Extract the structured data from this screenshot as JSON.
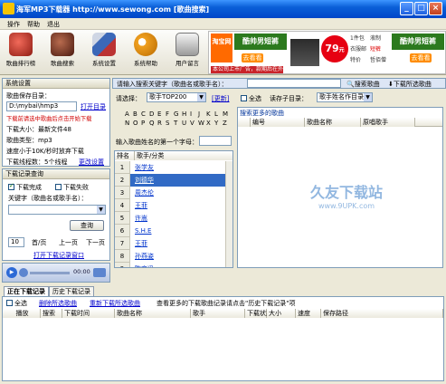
{
  "window": {
    "title": "海军MP3下载器   http://www.sewong.com   [歌曲搜索]",
    "minimize": "_",
    "maximize": "□",
    "close": "×"
  },
  "menu": [
    "操作",
    "帮助",
    "退出"
  ],
  "toolbar": [
    {
      "label": "歌曲排行榜",
      "icon": "music-chart-icon",
      "color": "#c23a2e"
    },
    {
      "label": "歌曲搜索",
      "icon": "music-search-icon",
      "color": "#7d3525"
    },
    {
      "label": "系统设置",
      "icon": "settings-tools-icon",
      "color": "#3b68b8"
    },
    {
      "label": "系统帮助",
      "icon": "owl-help-icon",
      "color": "#e08a00"
    },
    {
      "label": "用户留言",
      "icon": "guestbook-icon",
      "color": "#8b8b8b"
    }
  ],
  "ad": {
    "brand": "淘宝网",
    "slogan": "酷帅男短裤",
    "cta": "去看看",
    "price": "79",
    "price_unit": "元",
    "tagline": "潮流 型格 短裤",
    "right_items": [
      "1件包",
      "液制",
      "衣服邮",
      "短裤",
      "特价",
      "哲佰僧"
    ],
    "right_title": "酷帅男短裤",
    "right_cta": "去看看",
    "notice": "本公司上市广告，款期后在外"
  },
  "system_settings": {
    "header": "系统设置",
    "save_dir_label": "歌曲保存目录：",
    "save_dir_value": "D:\\mybai\\hmp3",
    "open_dir": "打开目录",
    "warning": "下载前请选中歌曲后点击开始下载",
    "size_label": "下载大小：最新文件48",
    "type_label": "歌曲类型：mp3",
    "speed_label": "速度小于10K/秒时放弃下载",
    "threads_label": "下载线程数：5个线程",
    "change_settings": "更改设置"
  },
  "download_query": {
    "header": "下载记录查询",
    "complete": "下载完成",
    "failed": "下载失败",
    "keyword_label": "关键字（歌曲名或歌手名）：",
    "query": "查询",
    "page_size": "10",
    "per_page": "首/页",
    "prev": "上一页",
    "next": "下一页",
    "open_window": "打开下载记录窗口"
  },
  "player": {
    "time": "00:00"
  },
  "search": {
    "prompt": "请输入搜索关键字（歌曲名或歌手名）：",
    "input": "",
    "search_btn": "搜索歌曲",
    "download_btn": "下载所选歌曲",
    "choose_label": "请选择：",
    "choose_value": "歌手TOP200",
    "refresh": "[更新]",
    "select_all": "全选",
    "singer_dir_label": "读存子目录：",
    "singer_dir_value": "歌手姓名作目录"
  },
  "alphabet": [
    [
      "A",
      "B",
      "C",
      "D",
      "E",
      "F",
      "G",
      "H",
      "I",
      "J",
      "K",
      "L",
      "M"
    ],
    [
      "N",
      "O",
      "P",
      "Q",
      "R",
      "S",
      "T",
      "U",
      "V",
      "W",
      "X",
      "Y",
      "Z"
    ]
  ],
  "pinyin_label": "输入歌曲姓名的第一个字母：",
  "singer_table": {
    "columns": [
      "排名",
      "歌手/分类"
    ],
    "rows": [
      {
        "rank": "1",
        "name": "张学友"
      },
      {
        "rank": "2",
        "name": "刘德华"
      },
      {
        "rank": "3",
        "name": "周杰伦"
      },
      {
        "rank": "4",
        "name": "王菲"
      },
      {
        "rank": "5",
        "name": "许嵩"
      },
      {
        "rank": "6",
        "name": "S.H.E"
      },
      {
        "rank": "7",
        "name": "王菲"
      },
      {
        "rank": "8",
        "name": "孙燕姿"
      },
      {
        "rank": "9",
        "name": "陈奕迅"
      }
    ]
  },
  "results": {
    "header": "搜索更多的歌曲",
    "columns": [
      "编号",
      "歌曲名称",
      "原唱歌手"
    ]
  },
  "watermark": {
    "title": "久友下载站",
    "url": "www.9UPK.com"
  },
  "bottom": {
    "tabs": [
      "正在下载记录",
      "历史下载记录"
    ],
    "select_all": "全选",
    "delete_selected": "删除所选歌曲",
    "redownload": "重新下载所选歌曲",
    "hint": "查看更多的下载歌曲记录请点击\"历史下载记录\"项",
    "columns": [
      "播放",
      "搜索",
      "下载时间",
      "歌曲名称",
      "歌手",
      "下载状态",
      "大小",
      "速度",
      "保存路径"
    ]
  },
  "colors": {
    "titlebar": "#0a5fd8",
    "link": "#0000cc",
    "warning": "#d00000",
    "selected_row": "#316ac5"
  }
}
